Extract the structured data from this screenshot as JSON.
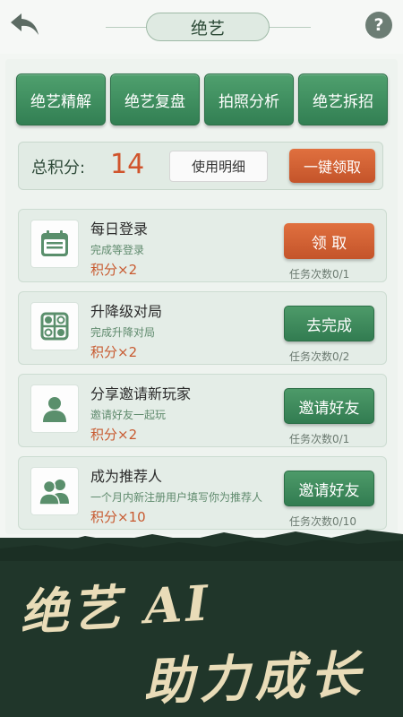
{
  "header": {
    "title": "绝艺",
    "back_icon": "back-arrow-icon",
    "help_label": "?"
  },
  "tools": [
    "绝艺精解",
    "绝艺复盘",
    "拍照分析",
    "绝艺拆招"
  ],
  "score": {
    "label": "总积分:",
    "value": "14",
    "detail_button": "使用明细",
    "claim_all_button": "一键领取"
  },
  "tasks": [
    {
      "title": "每日登录",
      "desc": "完成等登录",
      "points": "积分×2",
      "button": "领 取",
      "button_style": "orange",
      "count": "任务次数0/1",
      "icon": "calendar-icon"
    },
    {
      "title": "升降级对局",
      "desc": "完成升降对局",
      "points": "积分×2",
      "button": "去完成",
      "button_style": "green",
      "count": "任务次数0/2",
      "icon": "go-board-icon"
    },
    {
      "title": "分享邀请新玩家",
      "desc": "邀请好友一起玩",
      "points": "积分×2",
      "button": "邀请好友",
      "button_style": "green",
      "count": "任务次数0/1",
      "icon": "user-icon"
    },
    {
      "title": "成为推荐人",
      "desc": "一个月内新注册用户填写你为推荐人",
      "points": "积分×10",
      "button": "邀请好友",
      "button_style": "green",
      "count": "任务次数0/10",
      "icon": "users-icon"
    }
  ],
  "banner": {
    "line1": "绝艺 AI",
    "line2": "助力成长"
  },
  "colors": {
    "accent_green": "#3a8a5c",
    "accent_orange": "#d0542c",
    "banner_bg": "#20362a"
  }
}
